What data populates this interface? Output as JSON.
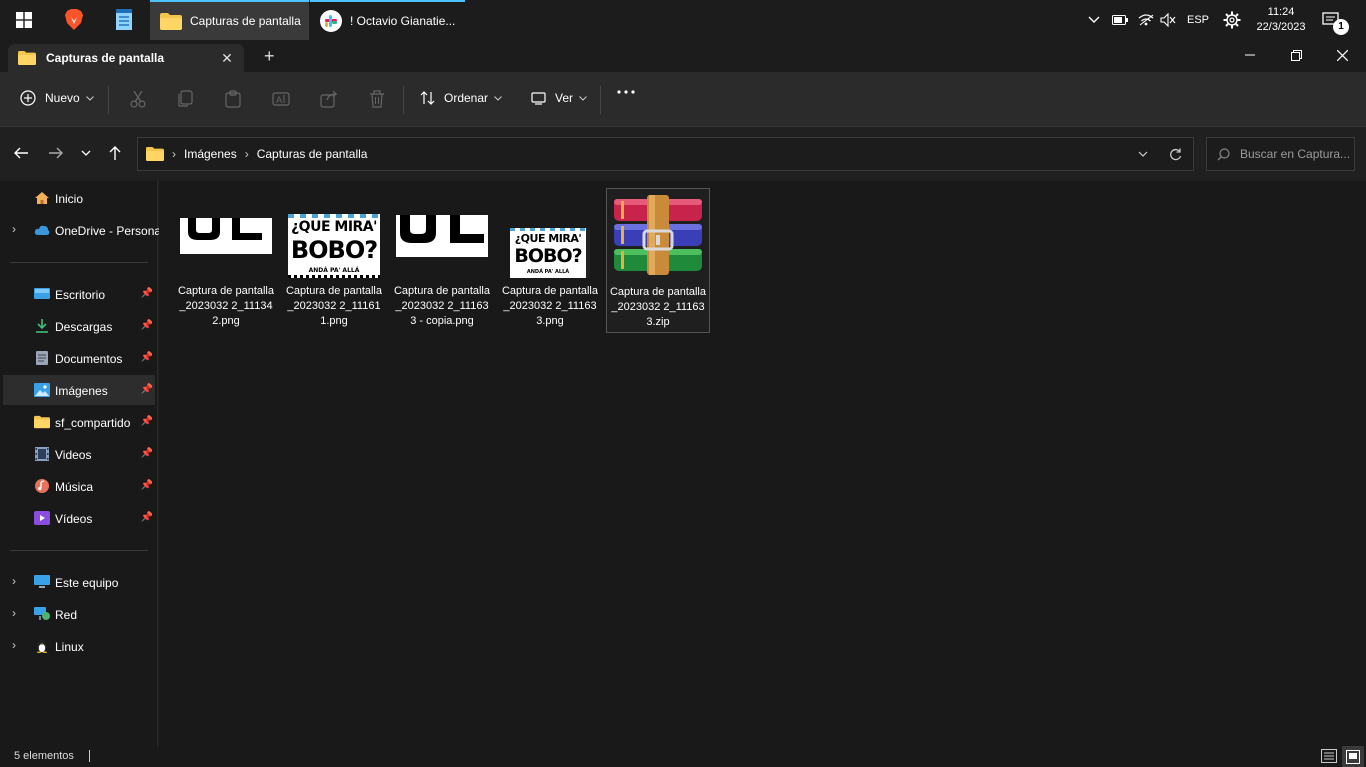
{
  "taskbar": {
    "apps": [
      {
        "name": "windows-start",
        "label": ""
      },
      {
        "name": "brave",
        "label": ""
      },
      {
        "name": "notepad",
        "label": ""
      },
      {
        "name": "explorer",
        "label": "Capturas de pantalla"
      },
      {
        "name": "slack",
        "label": "! Octavio Gianatie..."
      }
    ],
    "tray": {
      "language": "ESP",
      "time": "11:24",
      "date": "22/3/2023",
      "notifications": "1"
    }
  },
  "window": {
    "tab_title": "Capturas de pantalla",
    "toolbar": {
      "new_label": "Nuevo",
      "sort_label": "Ordenar",
      "view_label": "Ver"
    },
    "address": {
      "crumbs": [
        "Imágenes",
        "Capturas de pantalla"
      ]
    },
    "search": {
      "placeholder": "Buscar en Captura..."
    },
    "nav": {
      "items": [
        {
          "label": "Inicio"
        },
        {
          "label": "OneDrive - Persona"
        },
        {
          "label": "Escritorio"
        },
        {
          "label": "Descargas"
        },
        {
          "label": "Documentos"
        },
        {
          "label": "Imágenes"
        },
        {
          "label": "sf_compartido"
        },
        {
          "label": "Videos"
        },
        {
          "label": "Música"
        },
        {
          "label": "Vídeos"
        },
        {
          "label": "Este equipo"
        },
        {
          "label": "Red"
        },
        {
          "label": "Linux"
        }
      ]
    },
    "files": [
      {
        "name": "Captura de pantalla_20230322_111342.png",
        "kind": "image-ole"
      },
      {
        "name": "Captura de pantalla_20230322_111611.png",
        "kind": "image-bobo"
      },
      {
        "name": "Captura de pantalla_20230322_111633 - copia.png",
        "kind": "image-ole"
      },
      {
        "name": "Captura de pantalla_20230322_111633.png",
        "kind": "image-bobo"
      },
      {
        "name": "Captura de pantalla_20230322_111633.zip",
        "kind": "winrar-archive"
      }
    ],
    "file_labels": [
      "Captura de pantalla_2023032 2_111342.png",
      "Captura de pantalla_2023032 2_111611.png",
      "Captura de pantalla_2023032 2_111633 - copia.png",
      "Captura de pantalla_2023032 2_111633.png",
      "Captura de pantalla_2023032 2_111633.zip"
    ],
    "thumb_text": {
      "bobo_line1": "¿QUE MIRA'",
      "bobo_line2": "BOBO?",
      "bobo_line3": "ANDÁ PA' ALLÁ"
    },
    "status": {
      "count": "5 elementos"
    }
  }
}
